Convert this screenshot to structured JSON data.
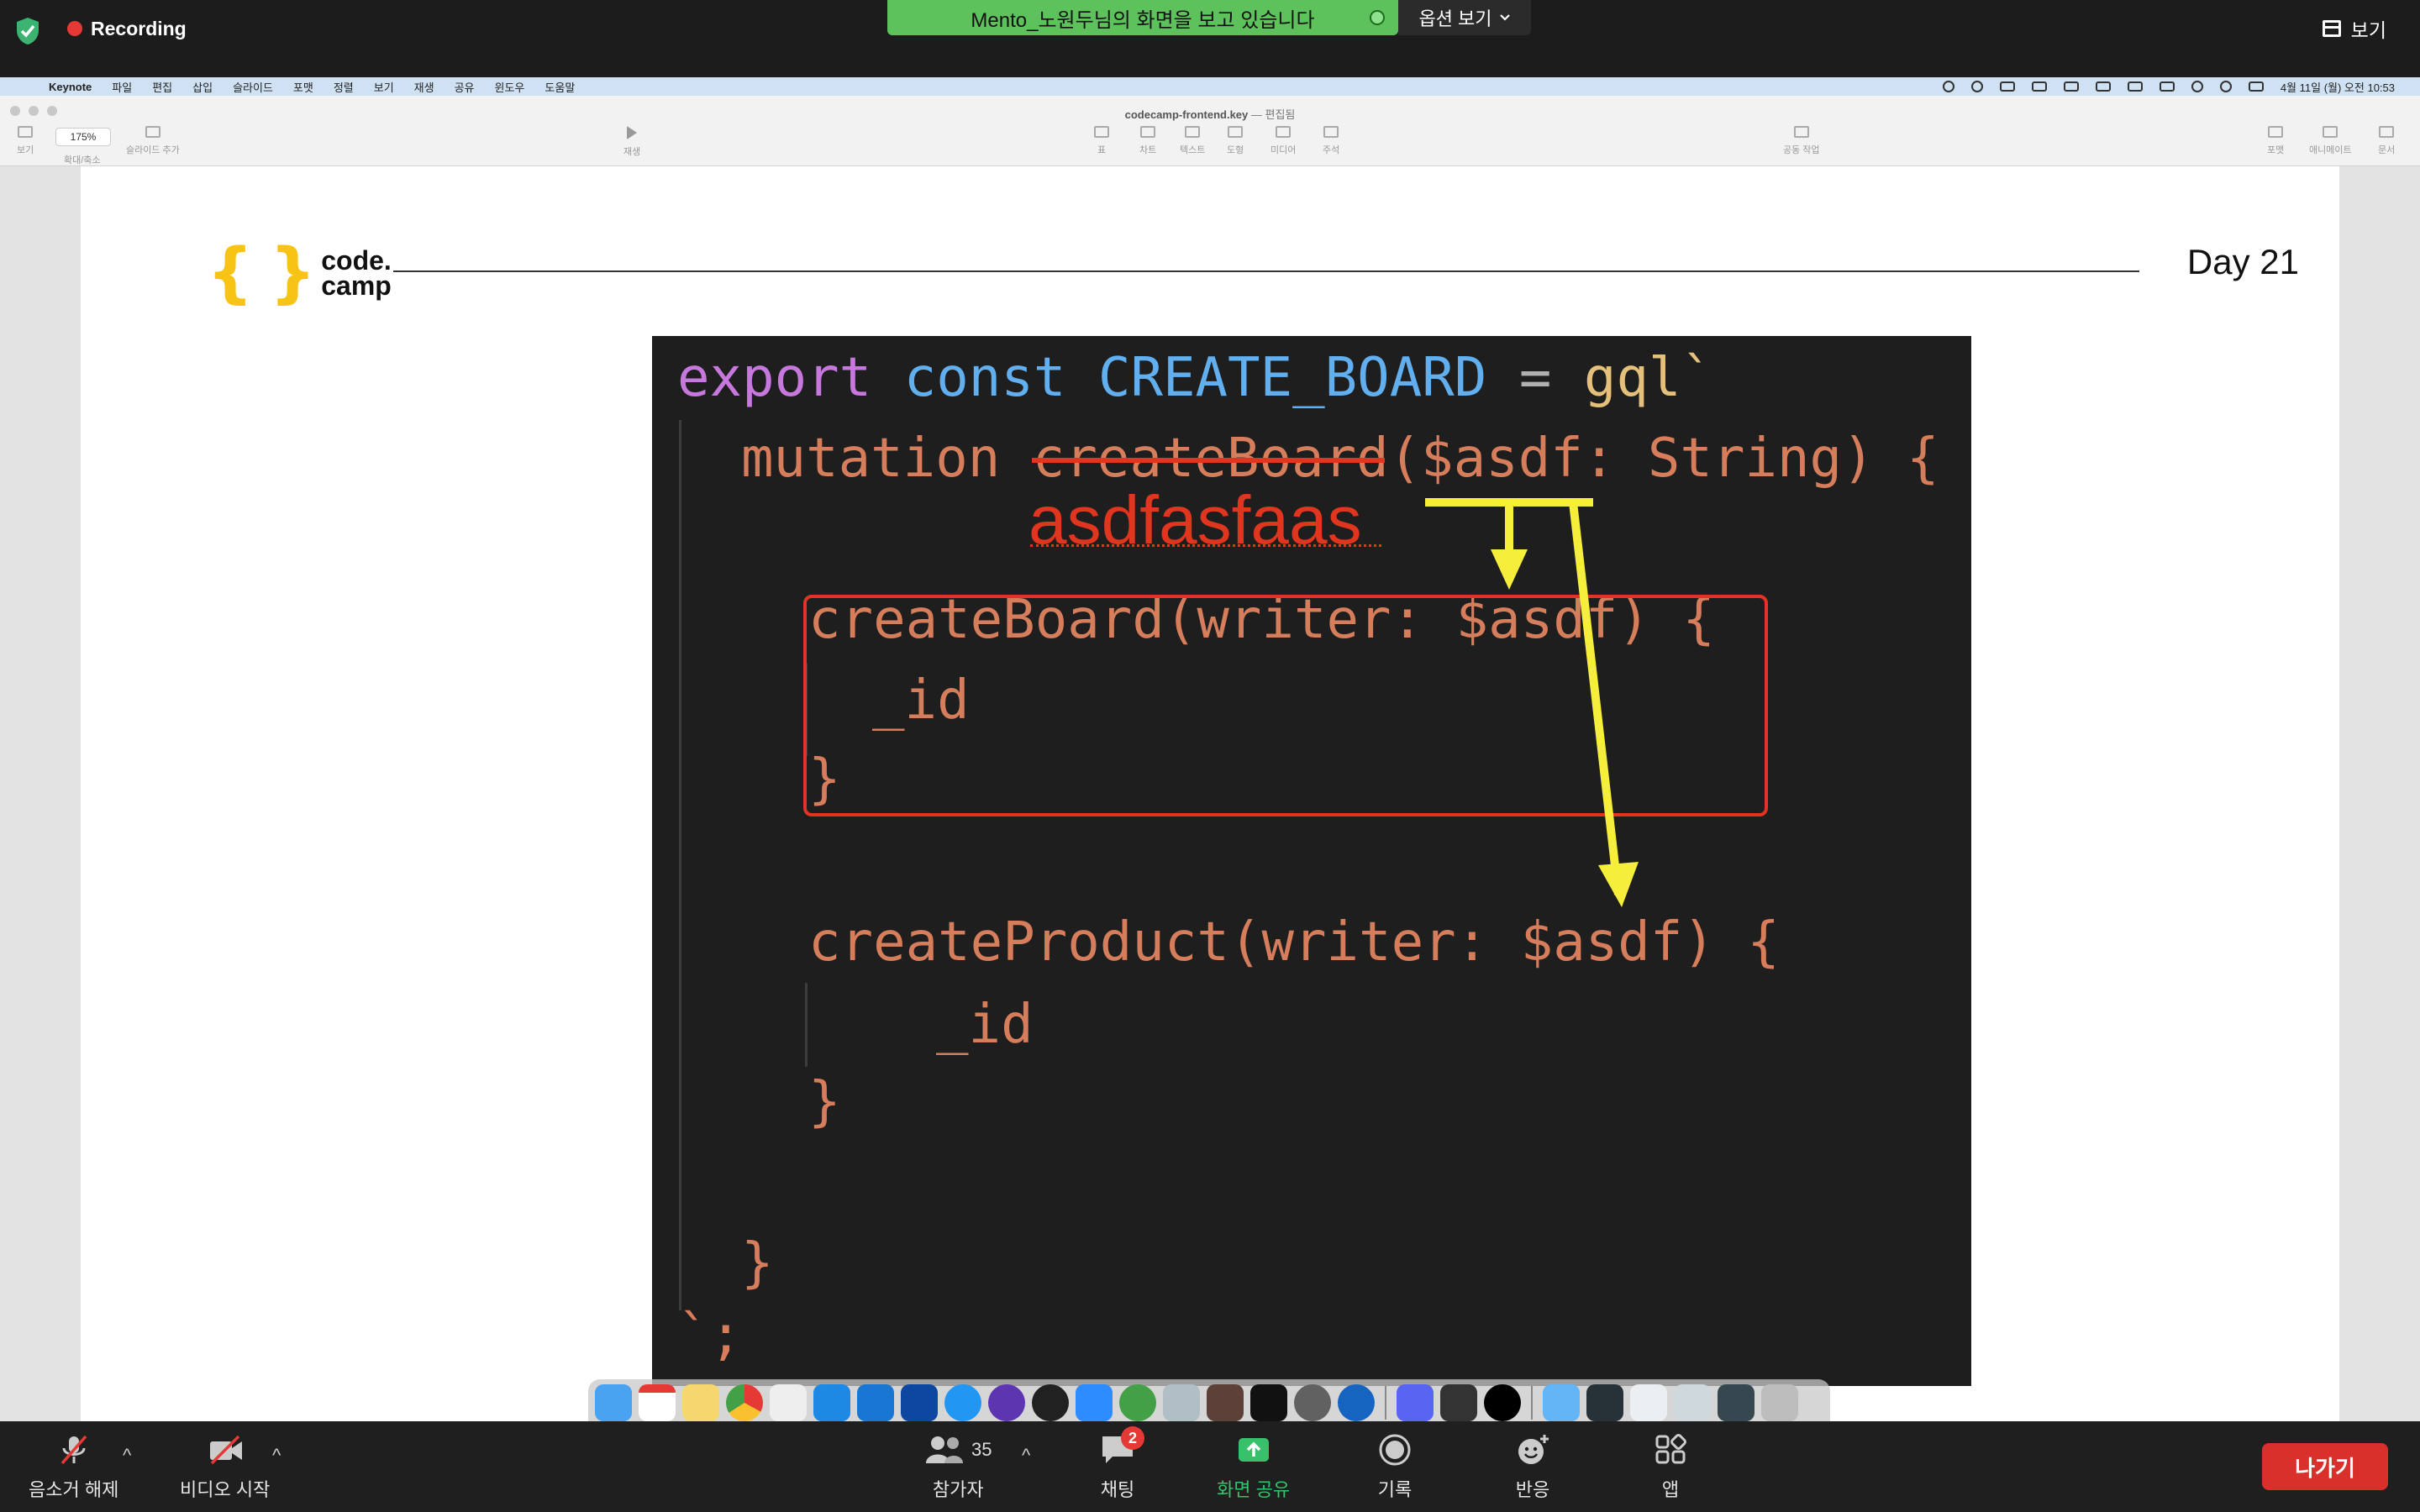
{
  "zoom_top": {
    "recording_label": "Recording",
    "share_banner": "Mento_노원두님의 화면을 보고 있습니다",
    "view_options": "옵션 보기",
    "view_button": "보기"
  },
  "menubar": {
    "app": "Keynote",
    "items": [
      "파일",
      "편집",
      "삽입",
      "슬라이드",
      "포맷",
      "정렬",
      "보기",
      "재생",
      "공유",
      "윈도우",
      "도움말"
    ],
    "clock": "4월 11일 (월) 오전 10:53"
  },
  "keynote": {
    "doc_title": "codecamp-frontend.key",
    "doc_status": "— 편집됨",
    "zoom": "175%",
    "left_buttons": [
      "보기",
      "확대/축소",
      "슬라이드 추가"
    ],
    "play_label": "재생",
    "insert_buttons": [
      "표",
      "차트",
      "텍스트",
      "도형",
      "미디어",
      "주석"
    ],
    "collab_label": "공동 작업",
    "right_buttons": [
      "포맷",
      "애니메이트",
      "문서"
    ]
  },
  "slide": {
    "logo_line1": "code.",
    "logo_line2": "camp",
    "day": "Day 21",
    "code": {
      "l1_export": "export",
      "l1_const": "const",
      "l1_name": "CREATE_BOARD",
      "l1_eq": "=",
      "l1_gql": "gql`",
      "l2_mutation": "mutation",
      "l2_struck": "createBoard",
      "l2_args": "($asdf: String) {",
      "l3": "createBoard(writer: $asdf) {",
      "l4": "_id",
      "l5": "}",
      "l6": "createProduct(writer: $asdf) {",
      "l7": "_id",
      "l8": "}",
      "l9": "}",
      "l10": "`;"
    },
    "annotation": "asdfasfaas"
  },
  "zoom_bottom": {
    "mute": "음소거 해제",
    "video": "비디오 시작",
    "participants": "참가자",
    "participants_count": "35",
    "chat": "채팅",
    "chat_badge": "2",
    "share": "화면 공유",
    "record": "기록",
    "reactions": "반응",
    "apps": "앱",
    "leave": "나가기"
  },
  "colors": {
    "zoom_bg": "#1c1c1c",
    "share_green": "#5ec25c",
    "annotation_red": "#e0351f",
    "arrow_yellow": "#f5ee3a",
    "code_bg": "#1e1e1e",
    "leave_red": "#d9302c"
  }
}
